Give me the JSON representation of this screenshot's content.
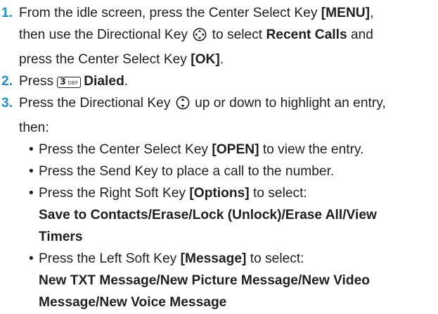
{
  "steps": [
    {
      "number": "1.",
      "t1": "From the idle screen, press the Center Select Key ",
      "b1": "[MENU]",
      "t2": ",",
      "t3": "then use the Directional Key ",
      "t4": " to select ",
      "b2": "Recent Calls",
      "t5": " and",
      "t6": "press the Center Select Key ",
      "b3": "[OK]",
      "t7": "."
    },
    {
      "number": "2.",
      "t1": "Press ",
      "key_digit": "3",
      "key_letters": "DEF",
      "b1": "Dialed",
      "t2": "."
    },
    {
      "number": "3.",
      "t1": "Press the Directional Key ",
      "t2": " up or down to highlight an entry,",
      "t3": "then:"
    }
  ],
  "bullets": [
    {
      "t1": "Press the Center Select Key ",
      "b1": "[OPEN]",
      "t2": " to view the entry."
    },
    {
      "t1": "Press the Send Key to place a call to the number."
    },
    {
      "t1": "Press the Right Soft Key ",
      "b1": "[Options]",
      "t2": " to select:",
      "opts_l1": "Save to Contacts/Erase/Lock (Unlock)/Erase All/View",
      "opts_l2": "Timers"
    },
    {
      "t1": "Press the Left Soft Key ",
      "b1": "[Message]",
      "t2": " to select:",
      "opts_l1": "New TXT Message/New Picture Message/New Video",
      "opts_l2": "Message/New Voice Message"
    }
  ],
  "icons": {
    "nav_key_4way": "four-way-directional-key-icon",
    "nav_key_updown": "up-down-directional-key-icon",
    "key_3def": "key-3-def-icon"
  },
  "colors": {
    "step_number": "#1f8fd6",
    "text": "#1f1f1f"
  }
}
